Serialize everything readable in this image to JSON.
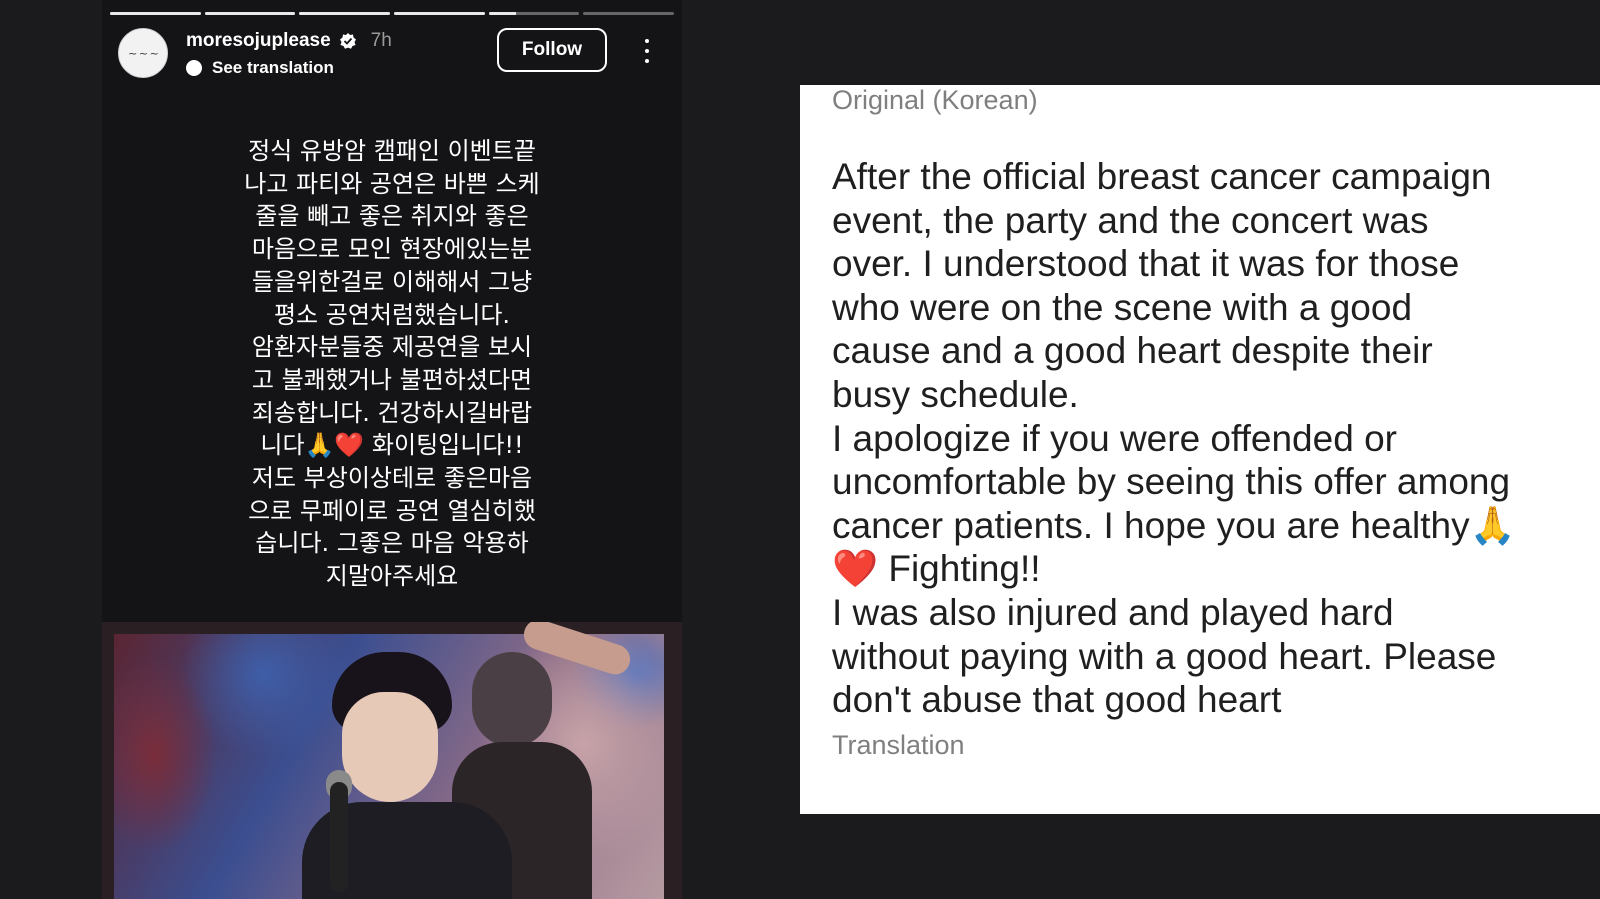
{
  "story": {
    "progress": [
      1,
      1,
      1,
      1,
      0.3,
      0
    ],
    "username": "moresojuplease",
    "age": "7h",
    "see_translation": "See translation",
    "follow_label": "Follow",
    "avatar_text": "~ ~ ~",
    "text": "정식 유방암 캠패인 이벤트끝\n나고 파티와 공연은 바쁜 스케\n줄을 빼고 좋은 취지와 좋은\n마음으로 모인 현장에있는분\n들을위한걸로 이해해서 그냥\n평소 공연처럼했습니다.\n암환자분들중 제공연을 보시\n고 불쾌했거나 불편하셨다면\n죄송합니다. 건강하시길바랍\n니다🙏❤️ 화이팅입니다!!\n저도 부상이상테로 좋은마음\n으로 무페이로 공연 열심히했\n습니다. 그좋은 마음 악용하\n지말아주세요"
  },
  "translation_card": {
    "original_label": "Original (Korean)",
    "text": "After the official breast cancer campaign\nevent, the party and the concert was\nover. I understood that it was for those\nwho were on the scene with a good\ncause and a good heart despite their\nbusy schedule.\nI apologize if you were offended or\nuncomfortable by seeing this offer among\ncancer patients. I hope you are healthy🙏\n❤️ Fighting!!\nI was also injured and played hard\nwithout paying with a good heart. Please\ndon't abuse that good heart",
    "translation_label": "Translation"
  },
  "colors": {
    "background": "#1b1b1e",
    "story_bg": "#141416",
    "card_bg": "#ffffff",
    "muted_text": "#7f7f7f"
  },
  "icons": [
    "verified-badge-icon",
    "translate-icon",
    "more-options-icon"
  ]
}
